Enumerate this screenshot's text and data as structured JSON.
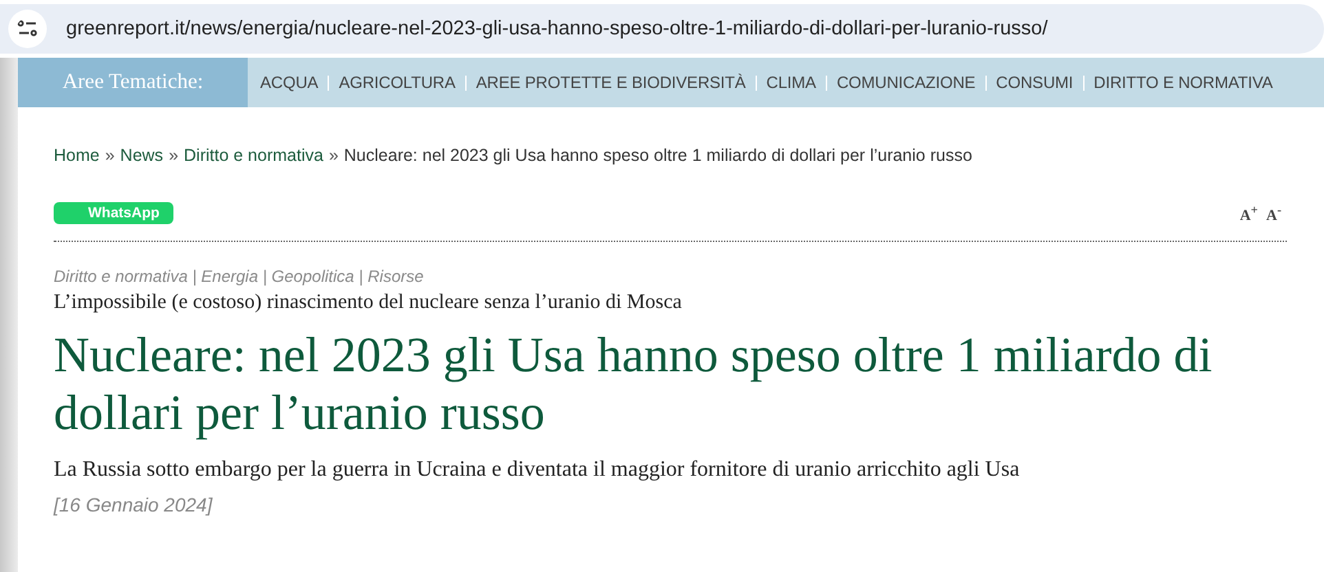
{
  "address_bar": {
    "url": "greenreport.it/news/energia/nucleare-nel-2023-gli-usa-hanno-speso-oltre-1-miliardo-di-dollari-per-luranio-russo/"
  },
  "nav": {
    "label": "Aree Tematiche:",
    "items": [
      "ACQUA",
      "AGRICOLTURA",
      "AREE PROTETTE E BIODIVERSITÀ",
      "CLIMA",
      "COMUNICAZIONE",
      "CONSUMI",
      "DIRITTO E NORMATIVA"
    ]
  },
  "breadcrumb": {
    "links": [
      "Home",
      "News",
      "Diritto e normativa"
    ],
    "separator": "»",
    "current": "Nucleare: nel 2023 gli Usa hanno speso oltre 1 miliardo di dollari per l’uranio russo"
  },
  "share": {
    "label": "WhatsApp"
  },
  "font_size_buttons": [
    "A$^{+}$",
    "A$^{-}$"
  ],
  "article": {
    "tags": "Diritto e normativa | Energia | Geopolitica | Risorse",
    "kicker": "L’impossibile (e costoso) rinascimento del nucleare senza l’uranio di Mosca",
    "title": "Nucleare: nel 2023 gli Usa hanno speso oltre 1 miliardo di dollari per l’uranio russo",
    "summary": "La Russia sotto embargo per la guerra in Ucraina e diventata il maggior fornitore di uranio arricchito agli Usa",
    "date": "[16 Gennaio 2024]"
  }
}
